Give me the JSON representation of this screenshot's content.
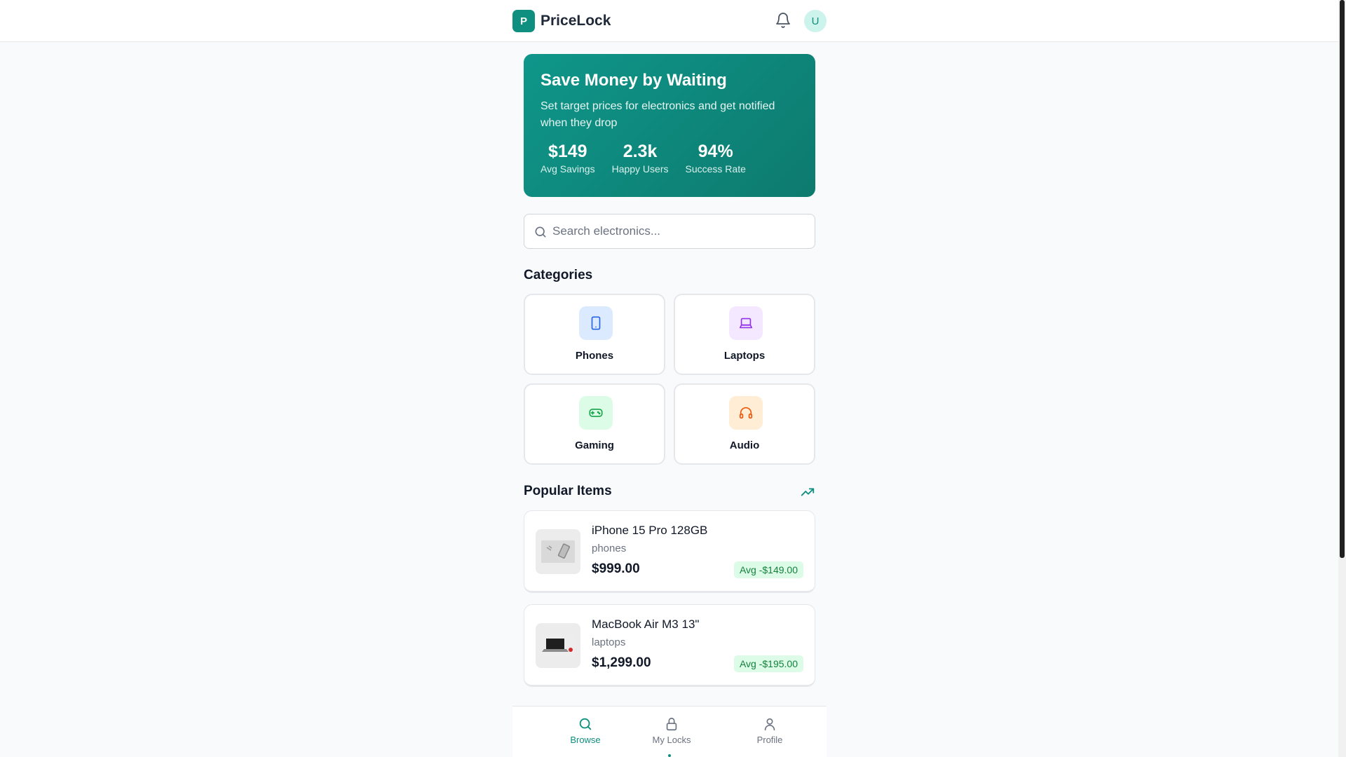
{
  "app": {
    "logo_letter": "P",
    "name": "PriceLock",
    "user_initial": "U"
  },
  "hero": {
    "title": "Save Money by Waiting",
    "subtitle": "Set target prices for electronics and get notified when they drop",
    "stats": [
      {
        "value": "$149",
        "label": "Avg Savings"
      },
      {
        "value": "2.3k",
        "label": "Happy Users"
      },
      {
        "value": "94%",
        "label": "Success Rate"
      }
    ]
  },
  "search": {
    "placeholder": "Search electronics..."
  },
  "categories": {
    "title": "Categories",
    "items": [
      {
        "label": "Phones",
        "icon": "smartphone-icon",
        "color": "#2563eb",
        "bg": "#dbeafe"
      },
      {
        "label": "Laptops",
        "icon": "laptop-icon",
        "color": "#9333ea",
        "bg": "#f3e8ff"
      },
      {
        "label": "Gaming",
        "icon": "gamepad-icon",
        "color": "#16a34a",
        "bg": "#dcfce7"
      },
      {
        "label": "Audio",
        "icon": "headphones-icon",
        "color": "#ea580c",
        "bg": "#ffedd5"
      }
    ]
  },
  "popular": {
    "title": "Popular Items",
    "items": [
      {
        "name": "iPhone 15 Pro 128GB",
        "category": "phones",
        "price": "$999.00",
        "badge": "Avg -$149.00"
      },
      {
        "name": "MacBook Air M3 13\"",
        "category": "laptops",
        "price": "$1,299.00",
        "badge": "Avg -$195.00"
      }
    ]
  },
  "nav": {
    "items": [
      {
        "label": "Browse",
        "icon": "search-icon",
        "active": true
      },
      {
        "label": "My Locks",
        "icon": "lock-icon",
        "active": false
      },
      {
        "label": "Profile",
        "icon": "user-icon",
        "active": false
      }
    ]
  },
  "colors": {
    "brand": "#0f8f7f",
    "badge_bg": "#dcfce7",
    "badge_text": "#15803d"
  }
}
